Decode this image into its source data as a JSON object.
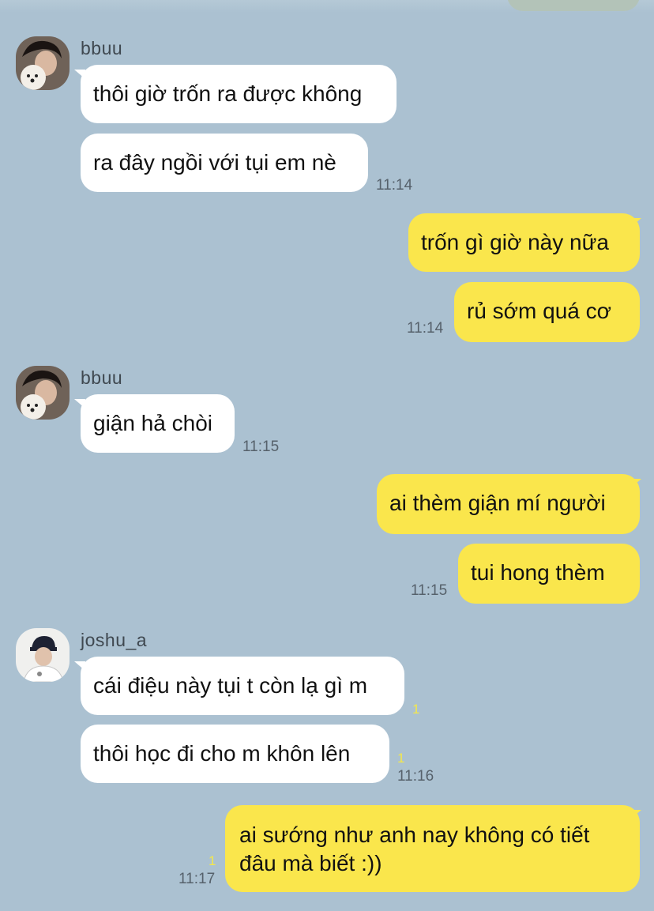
{
  "messages": [
    {
      "sender": "bbuu",
      "lines": [
        "thôi giờ trốn ra được không",
        "ra đây ngồi với tụi em nè"
      ],
      "time": "11:14"
    },
    {
      "sender": "me",
      "lines": [
        "trốn gì giờ này nữa",
        "rủ sớm quá cơ"
      ],
      "time": "11:14"
    },
    {
      "sender": "bbuu",
      "lines": [
        "giận hả chòi"
      ],
      "time": "11:15"
    },
    {
      "sender": "me",
      "lines": [
        "ai thèm giận mí người",
        "tui hong thèm"
      ],
      "time": "11:15"
    },
    {
      "sender": "joshu_a",
      "lines": [
        "cái điệu này tụi t còn lạ gì m",
        "thôi học đi cho m khôn lên"
      ],
      "unread": [
        "1",
        "1"
      ],
      "time": "11:16"
    },
    {
      "sender": "me",
      "lines": [
        "ai sướng như anh nay không có tiết",
        "đâu mà biết :))"
      ],
      "unread": "1",
      "time": "11:17"
    }
  ],
  "colors": {
    "background": "#abc1d1",
    "incoming_bubble": "#ffffff",
    "outgoing_bubble": "#fae64c",
    "unread_count": "#f4e84a"
  }
}
